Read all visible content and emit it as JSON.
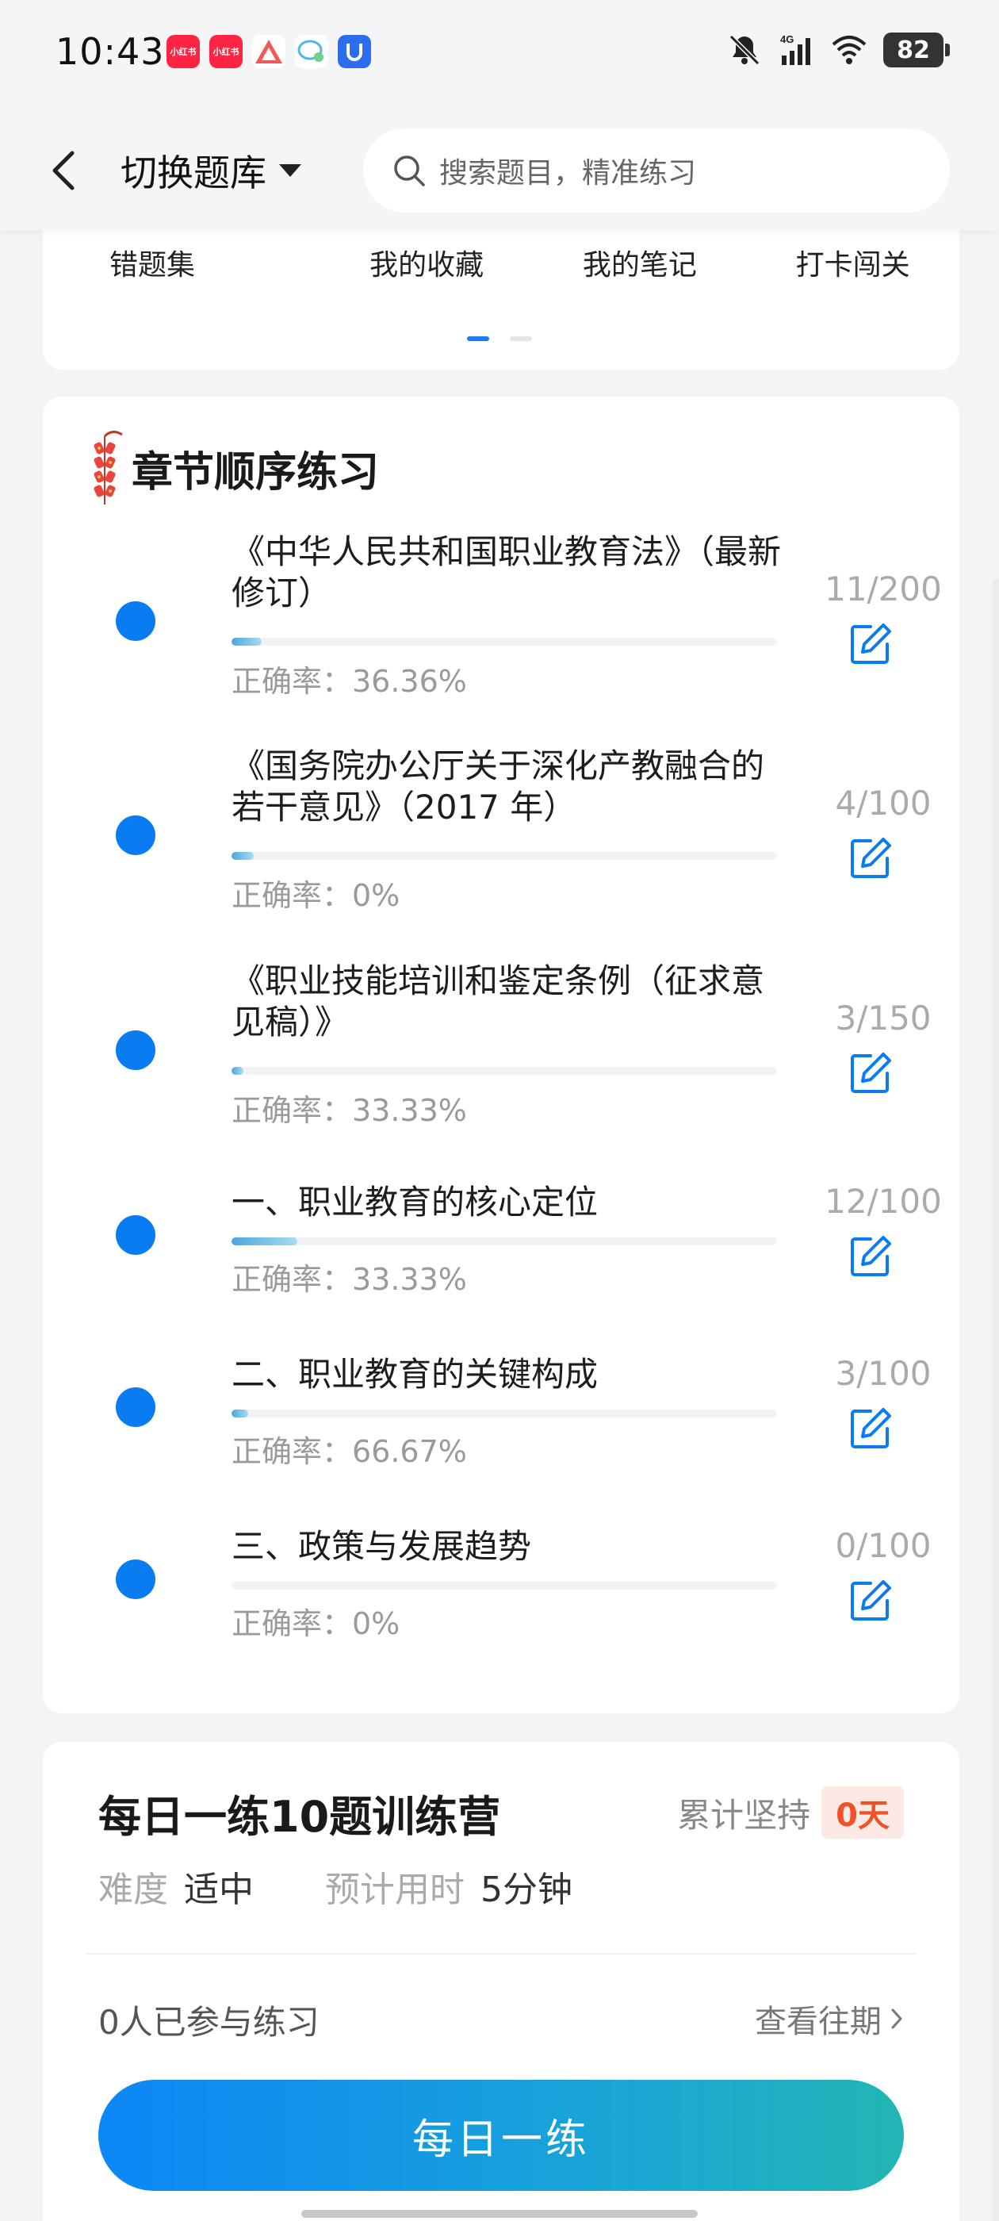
{
  "status_bar": {
    "time": "10:43",
    "apps": [
      {
        "label": "小红书",
        "color": "#ff2442"
      },
      {
        "label": "小红书",
        "color": "#ff2442"
      },
      {
        "label": "",
        "color": "#f25a5a"
      },
      {
        "label": "",
        "color": "#4fb7e8"
      },
      {
        "label": "",
        "color": "#2c6df0"
      }
    ],
    "battery": "82",
    "network": "4G"
  },
  "navbar": {
    "switch_label": "切换题库",
    "search_placeholder": "搜索题目，精准练习"
  },
  "shortcuts": {
    "items": [
      "错题集",
      "我的收藏",
      "我的笔记",
      "打卡闯关"
    ],
    "page_count": 2,
    "active_page": 0
  },
  "chapters": {
    "title": "章节顺序练习",
    "items": [
      {
        "title": "《中华人民共和国职业教育法》（最新修订）",
        "count": "11/200",
        "accuracy": "正确率：36.36%",
        "progress": 0.055
      },
      {
        "title": "《国务院办公厅关于深化产教融合的若干意见》（2017 年）",
        "count": "4/100",
        "accuracy": "正确率：0%",
        "progress": 0.04
      },
      {
        "title": "《职业技能培训和鉴定条例（征求意见稿）》",
        "count": "3/150",
        "accuracy": "正确率：33.33%",
        "progress": 0.02
      },
      {
        "title": "一、职业教育的核心定位",
        "count": "12/100",
        "accuracy": "正确率：33.33%",
        "progress": 0.12
      },
      {
        "title": "二、职业教育的关键构成",
        "count": "3/100",
        "accuracy": "正确率：66.67%",
        "progress": 0.03
      },
      {
        "title": "三、政策与发展趋势",
        "count": "0/100",
        "accuracy": "正确率：0%",
        "progress": 0
      }
    ]
  },
  "daily": {
    "title": "每日一练10题训练营",
    "streak_label": "累计坚持",
    "streak_value": "0天",
    "difficulty_label": "难度",
    "difficulty_value": "适中",
    "time_label": "预计用时",
    "time_value": "5分钟",
    "participants": "0人已参与练习",
    "history_label": "查看往期",
    "button_label": "每日一练"
  },
  "colors": {
    "accent": "#0a7cf2",
    "streak": "#f0502a"
  }
}
